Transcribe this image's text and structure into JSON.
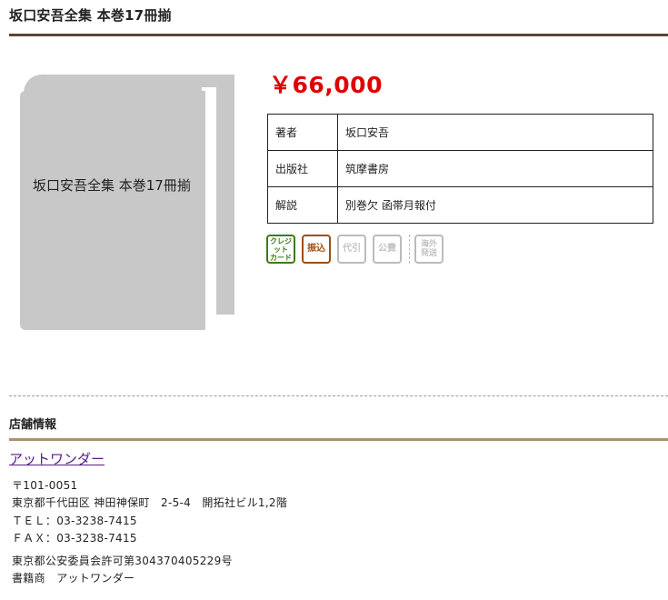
{
  "page": {
    "title": "坂口安吾全集 本巻17冊揃"
  },
  "book": {
    "placeholder_title": "坂口安吾全集 本巻17冊揃",
    "price": "￥66,000",
    "details": [
      {
        "key": "著者",
        "value": "坂口安吾"
      },
      {
        "key": "出版社",
        "value": "筑摩書房"
      },
      {
        "key": "解説",
        "value": "別巻欠 函帯月報付"
      }
    ]
  },
  "payment_icons": [
    {
      "icon": "credit-card-icon",
      "label": "クレジット\nカード",
      "enabled": true,
      "color": "#3c7a1a"
    },
    {
      "icon": "bank-transfer-icon",
      "label": "振込",
      "enabled": true,
      "color": "#a04d12"
    },
    {
      "icon": "cash-on-delivery-icon",
      "label": "代引",
      "enabled": false,
      "color": "#c4c4c4"
    },
    {
      "icon": "public-expense-icon",
      "label": "公費",
      "enabled": false,
      "color": "#c4c4c4"
    },
    {
      "icon": "overseas-shipping-icon",
      "label": "海外\n発送",
      "enabled": false,
      "color": "#c4c4c4"
    }
  ],
  "shop": {
    "heading": "店舗情報",
    "name": "アットワンダー",
    "postal": "〒101-0051",
    "address": "東京都千代田区 神田神保町　2-5-4　開拓社ビル1,2階",
    "tel": "ＴＥＬ：03-3238-7415",
    "fax": "ＦＡＸ：03-3238-7415",
    "license": "東京都公安委員会許可第304370405229号",
    "dealer": "書籍商　アットワンダー"
  },
  "colors": {
    "price": "#e00000",
    "title_rule": "#5a4632",
    "shop_rule": "#a89272",
    "link": "#551a8b"
  }
}
